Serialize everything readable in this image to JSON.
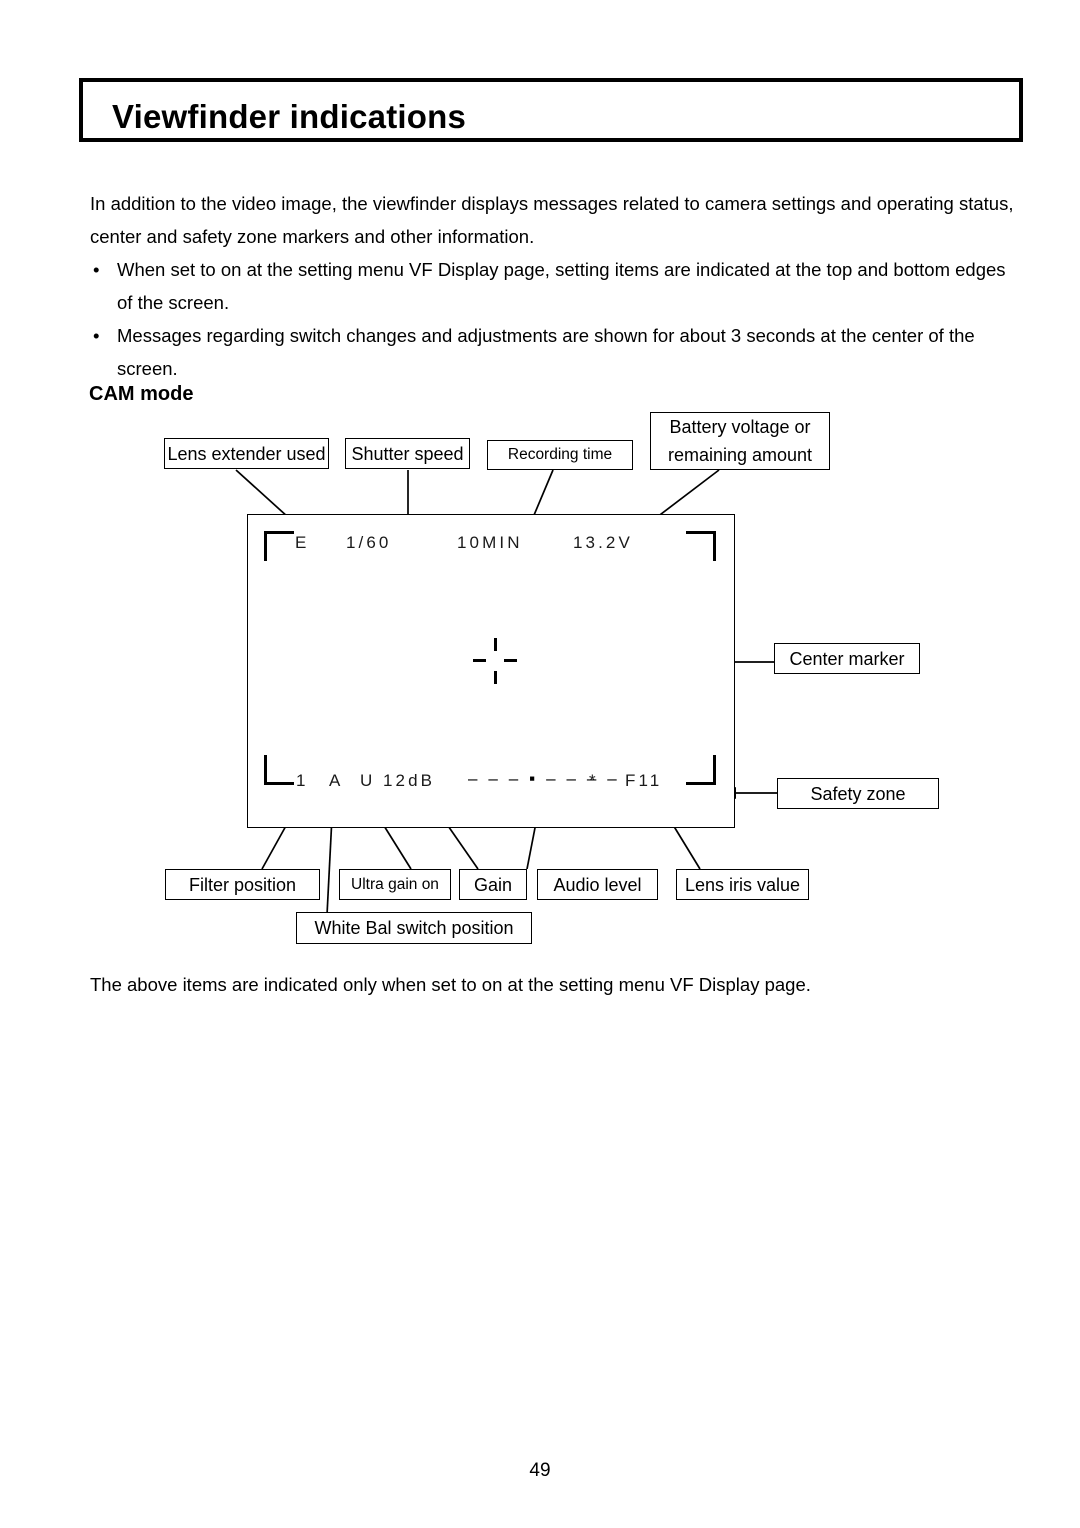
{
  "document": {
    "title": "Viewfinder indications",
    "page_number": "49",
    "section_heading": "CAM mode",
    "intro_paragraph": "In addition to the video image, the viewfinder displays messages related to camera settings and operating status, center and safety zone markers and other information.",
    "bullets": [
      "When set to on at the setting menu VF Display page, setting items are indicated at the top and bottom edges of the screen.",
      "Messages regarding switch changes and adjustments are shown for about 3 seconds at the center of the screen."
    ],
    "bullet_marker": "•",
    "footer_note": "The above items are indicated only when set to on at the setting menu VF Display page."
  },
  "viewfinder": {
    "top_row": {
      "lens_extender": "E",
      "shutter_speed": "1/60",
      "recording_time": "10MIN",
      "battery_voltage": "13.2V"
    },
    "bottom_row": {
      "filter_position": "1",
      "white_bal_switch": "A",
      "ultra_gain": "U",
      "gain": "12dB",
      "audio_level": "– – – ▪ – – – –",
      "audio_peak": "*",
      "lens_iris_value": "F11"
    },
    "center_marker_label": "center-marker"
  },
  "callouts": {
    "lens_extender_used": "Lens extender used",
    "shutter_speed": "Shutter speed",
    "recording_time": "Recording time",
    "battery_voltage": "Battery voltage or remaining amount",
    "center_marker": "Center marker",
    "safety_zone": "Safety zone",
    "filter_position": "Filter position",
    "ultra_gain_on": "Ultra gain on",
    "gain": "Gain",
    "audio_level": "Audio level",
    "lens_iris_value": "Lens iris value",
    "white_bal_switch_position": "White Bal switch position"
  },
  "colors": {
    "ink": "#000000",
    "page_background": "#ffffff",
    "osd_text": "#1a1a1a"
  }
}
